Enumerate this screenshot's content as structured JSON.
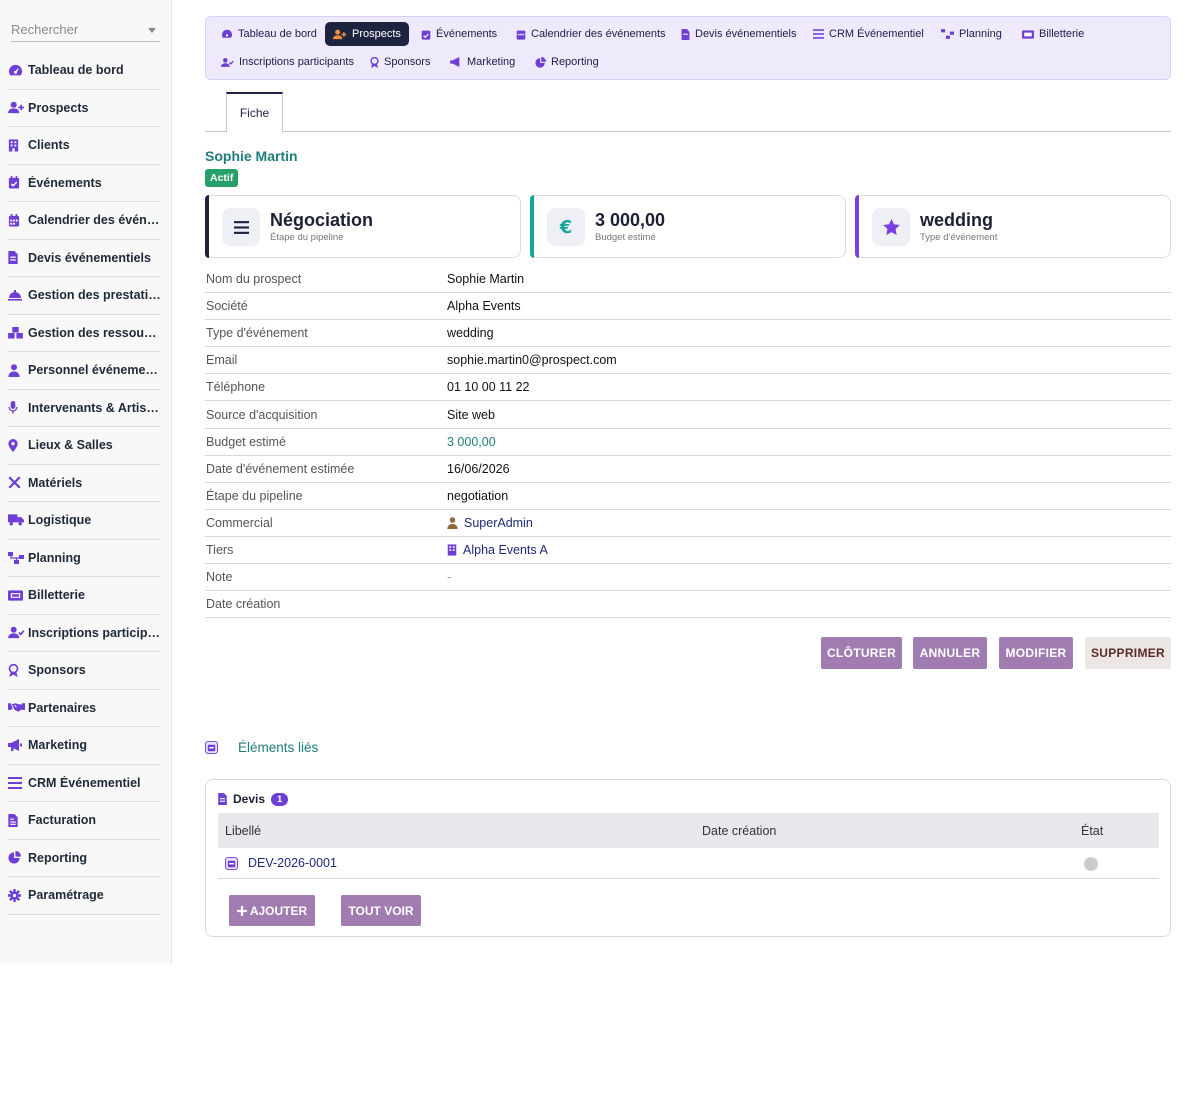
{
  "colors": {
    "accent": "#1e2440",
    "brand_purple": "#6d3fd6",
    "teal": "#1f7c7c",
    "action_button": "#a07cb0",
    "status_badge": "#28a06a"
  },
  "search": {
    "placeholder": "Rechercher"
  },
  "sidebar": {
    "items": [
      {
        "label": "Tableau de bord",
        "icon": "gauge-icon"
      },
      {
        "label": "Prospects",
        "icon": "user-plus-icon"
      },
      {
        "label": "Clients",
        "icon": "building-icon"
      },
      {
        "label": "Événements",
        "icon": "calendar-check-icon"
      },
      {
        "label": "Calendrier des événements",
        "icon": "calendar-icon"
      },
      {
        "label": "Devis événementiels",
        "icon": "file-invoice-icon"
      },
      {
        "label": "Gestion des prestations",
        "icon": "cloche-icon"
      },
      {
        "label": "Gestion des ressources",
        "icon": "boxes-icon"
      },
      {
        "label": "Personnel événementiel",
        "icon": "person-icon"
      },
      {
        "label": "Intervenants & Artistes",
        "icon": "microphone-icon"
      },
      {
        "label": "Lieux & Salles",
        "icon": "map-pin-icon"
      },
      {
        "label": "Matériels",
        "icon": "tools-icon"
      },
      {
        "label": "Logistique",
        "icon": "truck-icon"
      },
      {
        "label": "Planning",
        "icon": "sitemap-icon"
      },
      {
        "label": "Billetterie",
        "icon": "ticket-icon"
      },
      {
        "label": "Inscriptions participants",
        "icon": "user-check-icon"
      },
      {
        "label": "Sponsors",
        "icon": "award-icon"
      },
      {
        "label": "Partenaires",
        "icon": "handshake-icon"
      },
      {
        "label": "Marketing",
        "icon": "megaphone-icon"
      },
      {
        "label": "CRM Événementiel",
        "icon": "bars-icon"
      },
      {
        "label": "Facturation",
        "icon": "invoice-icon"
      },
      {
        "label": "Reporting",
        "icon": "pie-chart-icon"
      },
      {
        "label": "Paramétrage",
        "icon": "gear-icon"
      }
    ]
  },
  "topnav": {
    "items": [
      {
        "label": "Tableau de bord",
        "icon": "gauge-icon"
      },
      {
        "label": "Prospects",
        "icon": "user-plus-icon",
        "active": true
      },
      {
        "label": "Événements",
        "icon": "calendar-check-icon"
      },
      {
        "label": "Calendrier des événements",
        "icon": "calendar-icon"
      },
      {
        "label": "Devis événementiels",
        "icon": "file-invoice-icon"
      },
      {
        "label": "CRM Événementiel",
        "icon": "bars-icon"
      },
      {
        "label": "Planning",
        "icon": "sitemap-icon"
      },
      {
        "label": "Billetterie",
        "icon": "ticket-icon"
      },
      {
        "label": "Inscriptions participants",
        "icon": "user-check-icon"
      },
      {
        "label": "Sponsors",
        "icon": "award-icon"
      },
      {
        "label": "Marketing",
        "icon": "megaphone-icon"
      },
      {
        "label": "Reporting",
        "icon": "pie-chart-icon"
      }
    ]
  },
  "tabs": {
    "fiche": "Fiche"
  },
  "record": {
    "name": "Sophie Martin",
    "status": "Actif"
  },
  "kpis": [
    {
      "value": "Négociation",
      "label": "Étape du pipeline",
      "icon": "bars-icon",
      "color": "#1e2440"
    },
    {
      "value": "3 000,00",
      "label": "Budget estimé",
      "icon": "euro-icon",
      "color": "#13a89e"
    },
    {
      "value": "wedding",
      "label": "Type d'événement",
      "icon": "star-icon",
      "color": "#7b3fe0"
    }
  ],
  "details": [
    {
      "key": "Nom du prospect",
      "value": "Sophie Martin"
    },
    {
      "key": "Société",
      "value": "Alpha Events"
    },
    {
      "key": "Type d'événement",
      "value": "wedding"
    },
    {
      "key": "Email",
      "value": "sophie.martin0@prospect.com"
    },
    {
      "key": "Téléphone",
      "value": "01 10 00 11 22"
    },
    {
      "key": "Source d'acquisition",
      "value": "Site web"
    },
    {
      "key": "Budget estimé",
      "value": "3 000,00"
    },
    {
      "key": "Date d'événement estimée",
      "value": "16/06/2026"
    },
    {
      "key": "Étape du pipeline",
      "value": "negotiation"
    },
    {
      "key": "Commercial",
      "value": "SuperAdmin",
      "icon": "user-icon"
    },
    {
      "key": "Tiers",
      "value": "Alpha Events A",
      "icon": "building-icon"
    },
    {
      "key": "Note",
      "value": "-"
    },
    {
      "key": "Date création",
      "value": ""
    }
  ],
  "actions": {
    "close": "CLÔTURER",
    "cancel": "ANNULER",
    "edit": "MODIFIER",
    "delete": "SUPPRIMER"
  },
  "linked": {
    "title": "Éléments liés",
    "section": "Devis",
    "count": "1",
    "columns": [
      "Libellé",
      "Date création",
      "État"
    ],
    "rows": [
      {
        "ref": "DEV-2026-0001",
        "date": "",
        "state": "draft-grey"
      }
    ],
    "add_label": "AJOUTER",
    "add_icon": "plus-icon",
    "view_all_label": "TOUT VOIR"
  }
}
